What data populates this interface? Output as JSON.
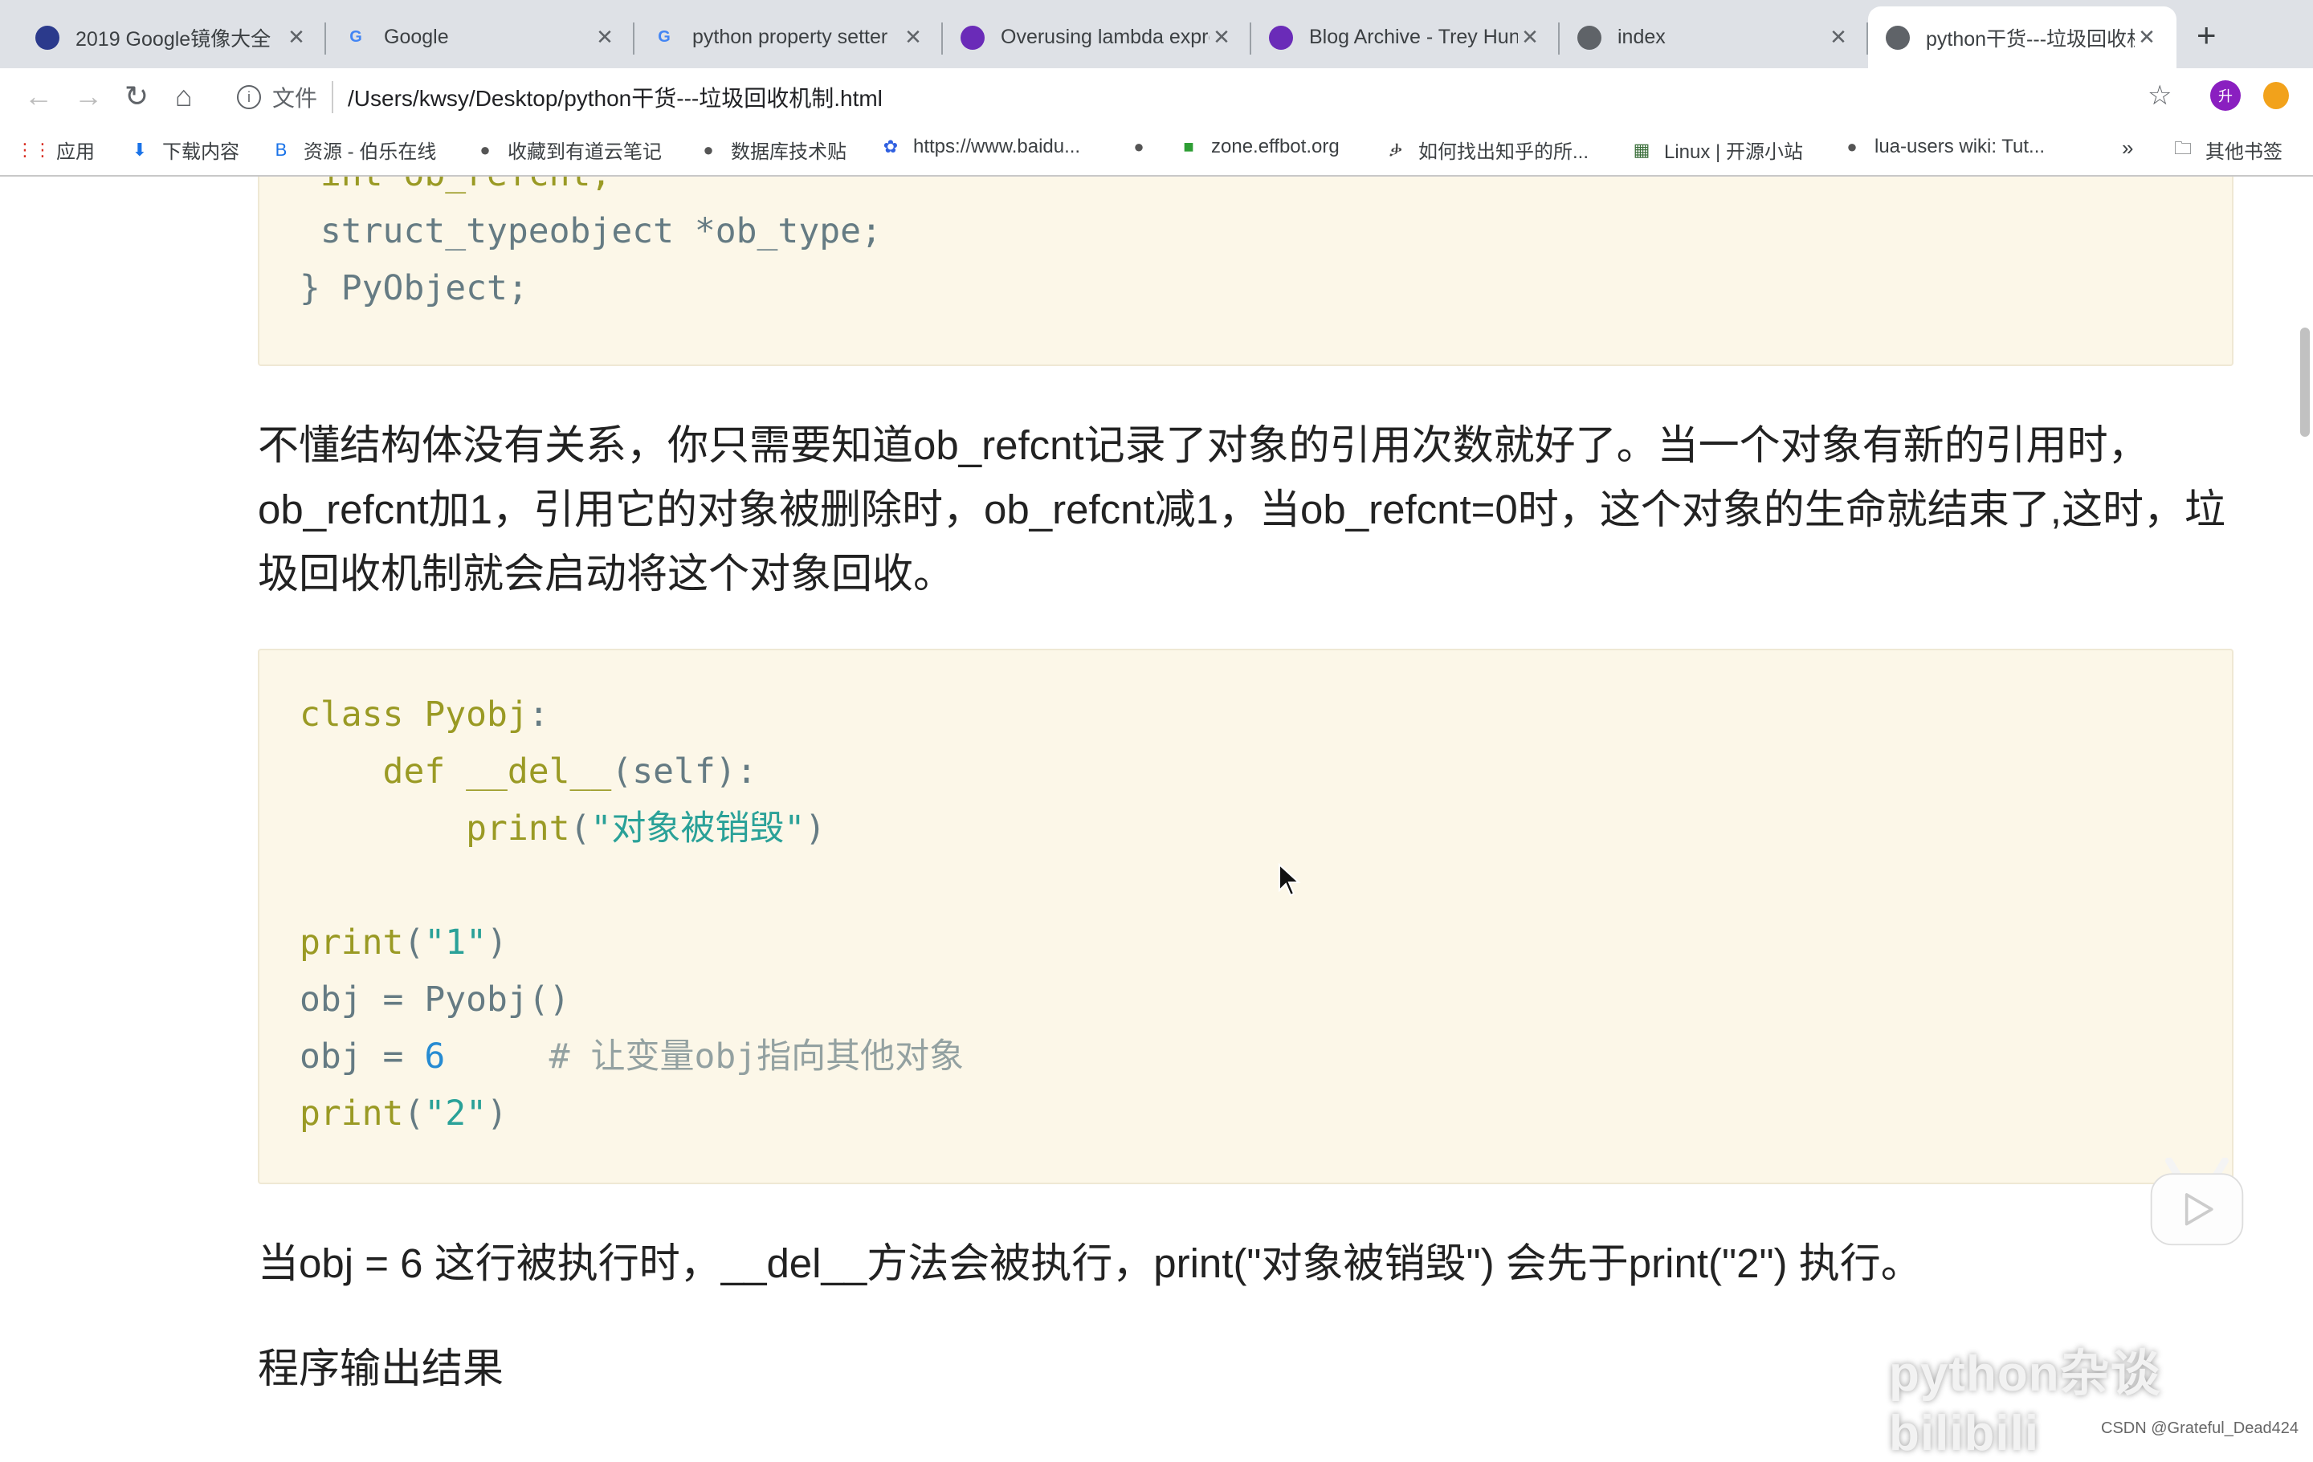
{
  "browser": {
    "tabs": [
      {
        "title": "2019 Google镜像大全",
        "icon": "feather-icon",
        "color": "#2b3a8c",
        "active": false
      },
      {
        "title": "Google",
        "icon": "google-icon",
        "color": "#4285f4",
        "active": false
      },
      {
        "title": "python property setter",
        "icon": "google-icon",
        "color": "#4285f4",
        "active": false
      },
      {
        "title": "Overusing lambda expressions",
        "icon": "treyhunner-icon",
        "color": "#6a2bb8",
        "active": false
      },
      {
        "title": "Blog Archive - Trey Hunner",
        "icon": "treyhunner-icon",
        "color": "#6a2bb8",
        "active": false
      },
      {
        "title": "index",
        "icon": "globe-icon",
        "color": "#5f6368",
        "active": false
      },
      {
        "title": "python干货---垃圾回收机制",
        "icon": "globe-icon",
        "color": "#5f6368",
        "active": true
      }
    ],
    "new_tab": "+",
    "address": {
      "scheme_label": "文件",
      "url": "/Users/kwsy/Desktop/python干货---垃圾回收机制.html"
    },
    "profile_avatar": "升",
    "bookmarks": [
      {
        "label": "应用",
        "icon": "apps-grid-icon"
      },
      {
        "label": "下载内容",
        "icon": "download-icon"
      },
      {
        "label": "资源 - 伯乐在线",
        "icon": "bole-icon"
      },
      {
        "label": "收藏到有道云笔记",
        "icon": "globe-icon"
      },
      {
        "label": "数据库技术贴",
        "icon": "globe-icon"
      },
      {
        "label": "https://www.baidu...",
        "icon": "baidu-paw-icon"
      },
      {
        "label": "",
        "icon": "globe-icon"
      },
      {
        "label": "zone.effbot.org",
        "icon": "green-square-icon"
      },
      {
        "label": "如何找出知乎的所...",
        "icon": "zhihu-icon"
      },
      {
        "label": "Linux | 开源小站",
        "icon": "linux-site-icon"
      },
      {
        "label": "lua-users wiki: Tut...",
        "icon": "globe-icon"
      }
    ],
    "more_bookmarks": "»",
    "other_bookmarks": "其他书签"
  },
  "colors": {
    "keyword": "#9a9a24",
    "string": "#2aa198",
    "number": "#268bd2",
    "comment": "#93a1a1",
    "plain": "#657b83"
  },
  "content": {
    "code1": [
      [
        {
          "t": " int ob_refcnt;",
          "c": "keyword"
        }
      ],
      [
        {
          "t": " struct_typeobject *ob_type;",
          "c": "plain"
        }
      ],
      [
        {
          "t": "} PyObject;",
          "c": "plain"
        }
      ]
    ],
    "paragraph1": "不懂结构体没有关系，你只需要知道ob_refcnt记录了对象的引用次数就好了。当一个对象有新的引用时，ob_refcnt加1，引用它的对象被删除时，ob_refcnt减1，当ob_refcnt=0时，这个对象的生命就结束了,这时，垃圾回收机制就会启动将这个对象回收。",
    "code2": [
      [
        {
          "t": "class Pyobj",
          "c": "keyword"
        },
        {
          "t": ":",
          "c": "plain"
        }
      ],
      [
        {
          "t": "    def __del__",
          "c": "keyword"
        },
        {
          "t": "(self):",
          "c": "plain"
        }
      ],
      [
        {
          "t": "        print",
          "c": "keyword"
        },
        {
          "t": "(",
          "c": "plain"
        },
        {
          "t": "\"对象被销毁\"",
          "c": "string"
        },
        {
          "t": ")",
          "c": "plain"
        }
      ],
      [],
      [
        {
          "t": "print",
          "c": "keyword"
        },
        {
          "t": "(",
          "c": "plain"
        },
        {
          "t": "\"1\"",
          "c": "string"
        },
        {
          "t": ")",
          "c": "plain"
        }
      ],
      [
        {
          "t": "obj = Pyobj()",
          "c": "plain"
        }
      ],
      [
        {
          "t": "obj = ",
          "c": "plain"
        },
        {
          "t": "6",
          "c": "number"
        },
        {
          "t": "     # 让变量obj指向其他对象",
          "c": "comment"
        }
      ],
      [
        {
          "t": "print",
          "c": "keyword"
        },
        {
          "t": "(",
          "c": "plain"
        },
        {
          "t": "\"2\"",
          "c": "string"
        },
        {
          "t": ")",
          "c": "plain"
        }
      ]
    ],
    "paragraph2": "当obj = 6 这行被执行时，__del__方法会被执行，print(\"对象被销毁\") 会先于print(\"2\") 执行。",
    "heading": "程序输出结果"
  },
  "overlay": {
    "watermark": "python杂谈 bilibili",
    "csdn": "CSDN @Grateful_Dead424"
  }
}
